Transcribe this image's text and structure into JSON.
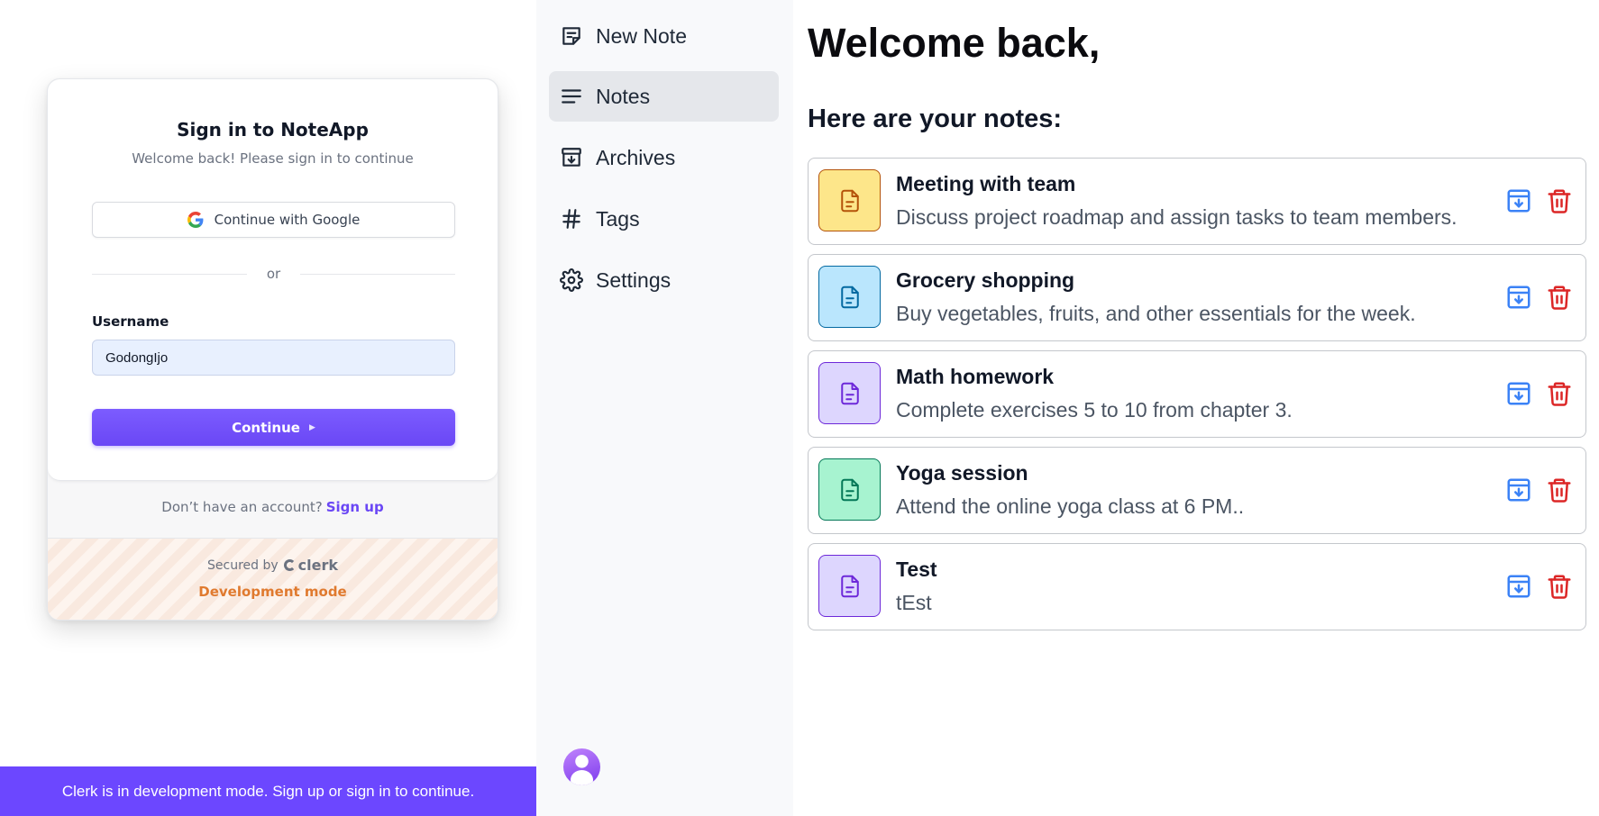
{
  "signin": {
    "title": "Sign in to NoteApp",
    "subtitle": "Welcome back! Please sign in to continue",
    "google_button": "Continue with Google",
    "divider": "or",
    "username_label": "Username",
    "username_value": "GodongIjo",
    "continue_button": "Continue",
    "no_account_text": "Don’t have an account?",
    "signup_link": "Sign up",
    "secured_by": "Secured by",
    "clerk_brand": "clerk",
    "dev_mode": "Development mode",
    "banner": "Clerk is in development mode. Sign up or sign in to continue."
  },
  "sidebar": {
    "items": [
      {
        "label": "New Note",
        "icon": "new-note-icon"
      },
      {
        "label": "Notes",
        "icon": "notes-icon",
        "active": true
      },
      {
        "label": "Archives",
        "icon": "archive-icon"
      },
      {
        "label": "Tags",
        "icon": "hash-icon"
      },
      {
        "label": "Settings",
        "icon": "gear-icon"
      }
    ]
  },
  "main": {
    "welcome": "Welcome back,",
    "notes_heading": "Here are your notes:",
    "notes": [
      {
        "title": "Meeting with team",
        "body": "Discuss project roadmap and assign tasks to team members.",
        "color": "#fde68a",
        "stroke": "#b45309"
      },
      {
        "title": "Grocery shopping",
        "body": "Buy vegetables, fruits, and other essentials for the week.",
        "color": "#bae6fd",
        "stroke": "#0369a1"
      },
      {
        "title": "Math homework",
        "body": "Complete exercises 5 to 10 from chapter 3.",
        "color": "#ddd6fe",
        "stroke": "#6d28d9"
      },
      {
        "title": "Yoga session",
        "body": "Attend the online yoga class at 6 PM..",
        "color": "#a7f3d0",
        "stroke": "#047857"
      },
      {
        "title": "Test",
        "body": "tEst",
        "color": "#ddd6fe",
        "stroke": "#6d28d9"
      }
    ]
  },
  "colors": {
    "accent": "#6c47ff",
    "archive": "#3b82f6",
    "delete": "#dc2626",
    "dev_mode": "#e07a2f"
  }
}
